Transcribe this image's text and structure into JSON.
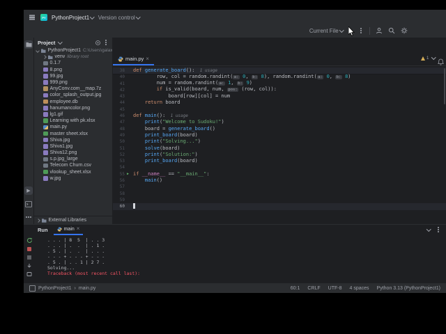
{
  "titlebar": {
    "project_name": "PythonProject1",
    "vcs_label": "Version control",
    "run_config": "Current File"
  },
  "project_panel": {
    "header": "Project",
    "root_name": "PythonProject1",
    "root_path": "C:\\Users\\galax\\PythonProje",
    "items": [
      {
        "type": "folder",
        "label": "venv",
        "annotation": "library root",
        "expand": true
      },
      {
        "type": "file",
        "label": "0.1.7"
      },
      {
        "type": "image",
        "label": "8.png"
      },
      {
        "type": "image",
        "label": "99.jpg"
      },
      {
        "type": "image",
        "label": "999.png"
      },
      {
        "type": "archive",
        "label": "AnyConv.com__map.7z"
      },
      {
        "type": "image",
        "label": "color_splash_output.jpg"
      },
      {
        "type": "db",
        "label": "employee.db"
      },
      {
        "type": "image",
        "label": "hanumancolor.png"
      },
      {
        "type": "image",
        "label": "lg1.gif"
      },
      {
        "type": "excel",
        "label": "Learning with pk.xlsx"
      },
      {
        "type": "py",
        "label": "main.py"
      },
      {
        "type": "excel",
        "label": "master sheet.xlsx"
      },
      {
        "type": "image",
        "label": "Shiva.jpg"
      },
      {
        "type": "image",
        "label": "Shiva1.jpg"
      },
      {
        "type": "image",
        "label": "Shiva12.png"
      },
      {
        "type": "file",
        "label": "s.p.jpg_large"
      },
      {
        "type": "csv",
        "label": "Telecom Churn.csv"
      },
      {
        "type": "excel",
        "label": "vlookup_sheet.xlsx"
      },
      {
        "type": "image",
        "label": "w.jpg"
      }
    ],
    "external_libraries": "External Libraries"
  },
  "editor": {
    "tab_name": "main.py",
    "warning_count": "1",
    "lines": [
      {
        "n": 38,
        "sticky": true,
        "seg": [
          [
            "k",
            "def "
          ],
          [
            "f",
            "generate_board"
          ],
          [
            "p",
            "():"
          ],
          [
            "u",
            "  1 usage"
          ]
        ]
      },
      {
        "n": 40,
        "seg": [
          [
            "p",
            "        row, col = random.randint("
          ],
          [
            "h",
            "a:"
          ],
          [
            "p",
            " "
          ],
          [
            "num",
            "0"
          ],
          [
            "p",
            ", "
          ],
          [
            "h",
            "b:"
          ],
          [
            "p",
            " "
          ],
          [
            "num",
            "8"
          ],
          [
            "p",
            "), random.randint("
          ],
          [
            "h",
            "a:"
          ],
          [
            "p",
            " "
          ],
          [
            "num",
            "0"
          ],
          [
            "p",
            ", "
          ],
          [
            "h",
            "b:"
          ],
          [
            "p",
            " "
          ],
          [
            "num",
            "8"
          ],
          [
            "p",
            ")"
          ]
        ]
      },
      {
        "n": 41,
        "seg": [
          [
            "p",
            "        num = random.randint("
          ],
          [
            "h",
            "a:"
          ],
          [
            "p",
            " "
          ],
          [
            "num",
            "1"
          ],
          [
            "p",
            ", "
          ],
          [
            "h",
            "b:"
          ],
          [
            "p",
            " "
          ],
          [
            "num",
            "9"
          ],
          [
            "p",
            ")"
          ]
        ]
      },
      {
        "n": 42,
        "seg": [
          [
            "p",
            "        "
          ],
          [
            "k",
            "if "
          ],
          [
            "p",
            "is_valid(board, num, "
          ],
          [
            "h",
            "pos:"
          ],
          [
            "p",
            " (row, col)):"
          ]
        ]
      },
      {
        "n": 43,
        "seg": [
          [
            "p",
            "            board[row][col] = num"
          ]
        ]
      },
      {
        "n": 44,
        "seg": [
          [
            "p",
            "    "
          ],
          [
            "k",
            "return"
          ],
          [
            "p",
            " board"
          ]
        ]
      },
      {
        "n": 45,
        "seg": []
      },
      {
        "n": 46,
        "seg": [
          [
            "k",
            "def "
          ],
          [
            "f",
            "main"
          ],
          [
            "p",
            "():"
          ],
          [
            "u",
            "  1 usage"
          ]
        ]
      },
      {
        "n": 47,
        "seg": [
          [
            "p",
            "    "
          ],
          [
            "f",
            "print"
          ],
          [
            "p",
            "("
          ],
          [
            "s",
            "\"Welcome to Sudoku!\""
          ],
          [
            "p",
            ")"
          ]
        ]
      },
      {
        "n": 48,
        "seg": [
          [
            "p",
            "    board = "
          ],
          [
            "f",
            "generate_board"
          ],
          [
            "p",
            "()"
          ]
        ]
      },
      {
        "n": 49,
        "seg": [
          [
            "p",
            "    "
          ],
          [
            "f",
            "print_board"
          ],
          [
            "p",
            "(board)"
          ]
        ]
      },
      {
        "n": 50,
        "seg": [
          [
            "p",
            "    "
          ],
          [
            "f",
            "print"
          ],
          [
            "p",
            "("
          ],
          [
            "s",
            "\"Solving...\""
          ],
          [
            "p",
            ")"
          ]
        ]
      },
      {
        "n": 51,
        "seg": [
          [
            "p",
            "    "
          ],
          [
            "f",
            "solve"
          ],
          [
            "p",
            "(board)"
          ]
        ]
      },
      {
        "n": 52,
        "seg": [
          [
            "p",
            "    "
          ],
          [
            "f",
            "print"
          ],
          [
            "p",
            "("
          ],
          [
            "s",
            "\"Solution:\""
          ],
          [
            "p",
            ")"
          ]
        ]
      },
      {
        "n": 53,
        "seg": [
          [
            "p",
            "    "
          ],
          [
            "f",
            "print_board"
          ],
          [
            "p",
            "(board)"
          ]
        ]
      },
      {
        "n": 54,
        "seg": []
      },
      {
        "n": 55,
        "run": true,
        "seg": [
          [
            "k",
            "if "
          ],
          [
            "d",
            "__name__"
          ],
          [
            "p",
            " == "
          ],
          [
            "s",
            "\"__main__\""
          ],
          [
            "p",
            ":"
          ]
        ]
      },
      {
        "n": 56,
        "seg": [
          [
            "p",
            "    "
          ],
          [
            "f",
            "main"
          ],
          [
            "p",
            "()"
          ]
        ]
      },
      {
        "n": 57,
        "seg": []
      },
      {
        "n": 58,
        "seg": []
      },
      {
        "n": 59,
        "seg": []
      },
      {
        "n": 60,
        "caret": true,
        "seg": []
      }
    ]
  },
  "run_panel": {
    "label": "Run",
    "tab_name": "main",
    "console_lines": [
      {
        "cls": "t",
        "text": ". . . | 8  5  | . . 3"
      },
      {
        "cls": "t",
        "text": ". . . | .  .  | . 1 ."
      },
      {
        "cls": "t",
        "text": ". 5 . | .  .  | . . ."
      },
      {
        "cls": "t",
        "text": "- - - + - - - + - - -"
      },
      {
        "cls": "t",
        "text": ". 5 . | . . 1 | 2 7 ."
      },
      {
        "cls": "t",
        "text": "Solving..."
      },
      {
        "cls": "e",
        "text": "Traceback (most recent call last):"
      }
    ]
  },
  "status_bar": {
    "project": "PythonProject1",
    "sep": "›",
    "file": "main.py",
    "items": [
      "60:1",
      "CRLF",
      "UTF-8",
      "4 spaces",
      "Python 3.13 (PythonProject1)"
    ]
  },
  "colors": {
    "accent": "#3574f0",
    "run_green": "#5fad65",
    "error_red": "#f75464",
    "warning_yellow": "#d6ae58"
  }
}
